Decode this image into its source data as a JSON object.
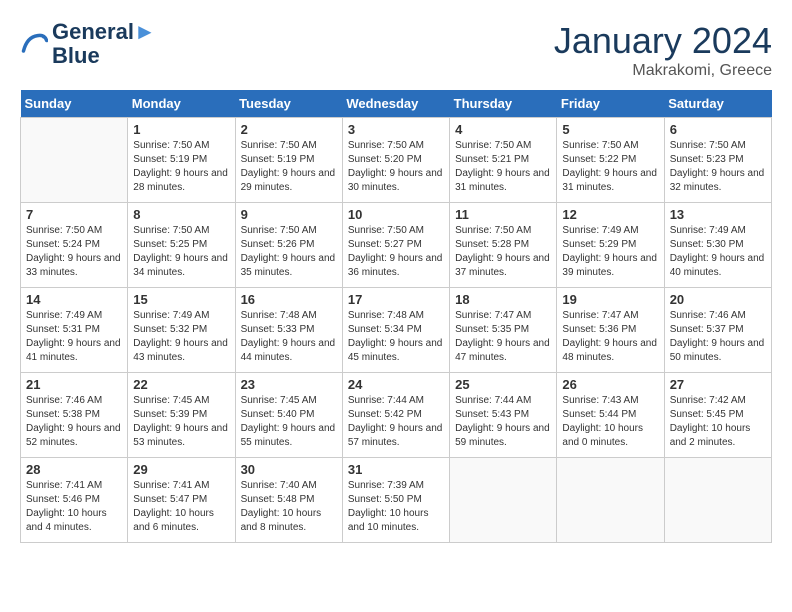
{
  "header": {
    "logo_line1": "General",
    "logo_line2": "Blue",
    "month": "January 2024",
    "location": "Makrakomi, Greece"
  },
  "columns": [
    "Sunday",
    "Monday",
    "Tuesday",
    "Wednesday",
    "Thursday",
    "Friday",
    "Saturday"
  ],
  "weeks": [
    [
      {
        "day": "",
        "empty": true
      },
      {
        "day": "1",
        "sunrise": "7:50 AM",
        "sunset": "5:19 PM",
        "daylight": "9 hours and 28 minutes."
      },
      {
        "day": "2",
        "sunrise": "7:50 AM",
        "sunset": "5:19 PM",
        "daylight": "9 hours and 29 minutes."
      },
      {
        "day": "3",
        "sunrise": "7:50 AM",
        "sunset": "5:20 PM",
        "daylight": "9 hours and 30 minutes."
      },
      {
        "day": "4",
        "sunrise": "7:50 AM",
        "sunset": "5:21 PM",
        "daylight": "9 hours and 31 minutes."
      },
      {
        "day": "5",
        "sunrise": "7:50 AM",
        "sunset": "5:22 PM",
        "daylight": "9 hours and 31 minutes."
      },
      {
        "day": "6",
        "sunrise": "7:50 AM",
        "sunset": "5:23 PM",
        "daylight": "9 hours and 32 minutes."
      }
    ],
    [
      {
        "day": "7",
        "sunrise": "7:50 AM",
        "sunset": "5:24 PM",
        "daylight": "9 hours and 33 minutes."
      },
      {
        "day": "8",
        "sunrise": "7:50 AM",
        "sunset": "5:25 PM",
        "daylight": "9 hours and 34 minutes."
      },
      {
        "day": "9",
        "sunrise": "7:50 AM",
        "sunset": "5:26 PM",
        "daylight": "9 hours and 35 minutes."
      },
      {
        "day": "10",
        "sunrise": "7:50 AM",
        "sunset": "5:27 PM",
        "daylight": "9 hours and 36 minutes."
      },
      {
        "day": "11",
        "sunrise": "7:50 AM",
        "sunset": "5:28 PM",
        "daylight": "9 hours and 37 minutes."
      },
      {
        "day": "12",
        "sunrise": "7:49 AM",
        "sunset": "5:29 PM",
        "daylight": "9 hours and 39 minutes."
      },
      {
        "day": "13",
        "sunrise": "7:49 AM",
        "sunset": "5:30 PM",
        "daylight": "9 hours and 40 minutes."
      }
    ],
    [
      {
        "day": "14",
        "sunrise": "7:49 AM",
        "sunset": "5:31 PM",
        "daylight": "9 hours and 41 minutes."
      },
      {
        "day": "15",
        "sunrise": "7:49 AM",
        "sunset": "5:32 PM",
        "daylight": "9 hours and 43 minutes."
      },
      {
        "day": "16",
        "sunrise": "7:48 AM",
        "sunset": "5:33 PM",
        "daylight": "9 hours and 44 minutes."
      },
      {
        "day": "17",
        "sunrise": "7:48 AM",
        "sunset": "5:34 PM",
        "daylight": "9 hours and 45 minutes."
      },
      {
        "day": "18",
        "sunrise": "7:47 AM",
        "sunset": "5:35 PM",
        "daylight": "9 hours and 47 minutes."
      },
      {
        "day": "19",
        "sunrise": "7:47 AM",
        "sunset": "5:36 PM",
        "daylight": "9 hours and 48 minutes."
      },
      {
        "day": "20",
        "sunrise": "7:46 AM",
        "sunset": "5:37 PM",
        "daylight": "9 hours and 50 minutes."
      }
    ],
    [
      {
        "day": "21",
        "sunrise": "7:46 AM",
        "sunset": "5:38 PM",
        "daylight": "9 hours and 52 minutes."
      },
      {
        "day": "22",
        "sunrise": "7:45 AM",
        "sunset": "5:39 PM",
        "daylight": "9 hours and 53 minutes."
      },
      {
        "day": "23",
        "sunrise": "7:45 AM",
        "sunset": "5:40 PM",
        "daylight": "9 hours and 55 minutes."
      },
      {
        "day": "24",
        "sunrise": "7:44 AM",
        "sunset": "5:42 PM",
        "daylight": "9 hours and 57 minutes."
      },
      {
        "day": "25",
        "sunrise": "7:44 AM",
        "sunset": "5:43 PM",
        "daylight": "9 hours and 59 minutes."
      },
      {
        "day": "26",
        "sunrise": "7:43 AM",
        "sunset": "5:44 PM",
        "daylight": "10 hours and 0 minutes."
      },
      {
        "day": "27",
        "sunrise": "7:42 AM",
        "sunset": "5:45 PM",
        "daylight": "10 hours and 2 minutes."
      }
    ],
    [
      {
        "day": "28",
        "sunrise": "7:41 AM",
        "sunset": "5:46 PM",
        "daylight": "10 hours and 4 minutes."
      },
      {
        "day": "29",
        "sunrise": "7:41 AM",
        "sunset": "5:47 PM",
        "daylight": "10 hours and 6 minutes."
      },
      {
        "day": "30",
        "sunrise": "7:40 AM",
        "sunset": "5:48 PM",
        "daylight": "10 hours and 8 minutes."
      },
      {
        "day": "31",
        "sunrise": "7:39 AM",
        "sunset": "5:50 PM",
        "daylight": "10 hours and 10 minutes."
      },
      {
        "day": "",
        "empty": true
      },
      {
        "day": "",
        "empty": true
      },
      {
        "day": "",
        "empty": true
      }
    ]
  ]
}
